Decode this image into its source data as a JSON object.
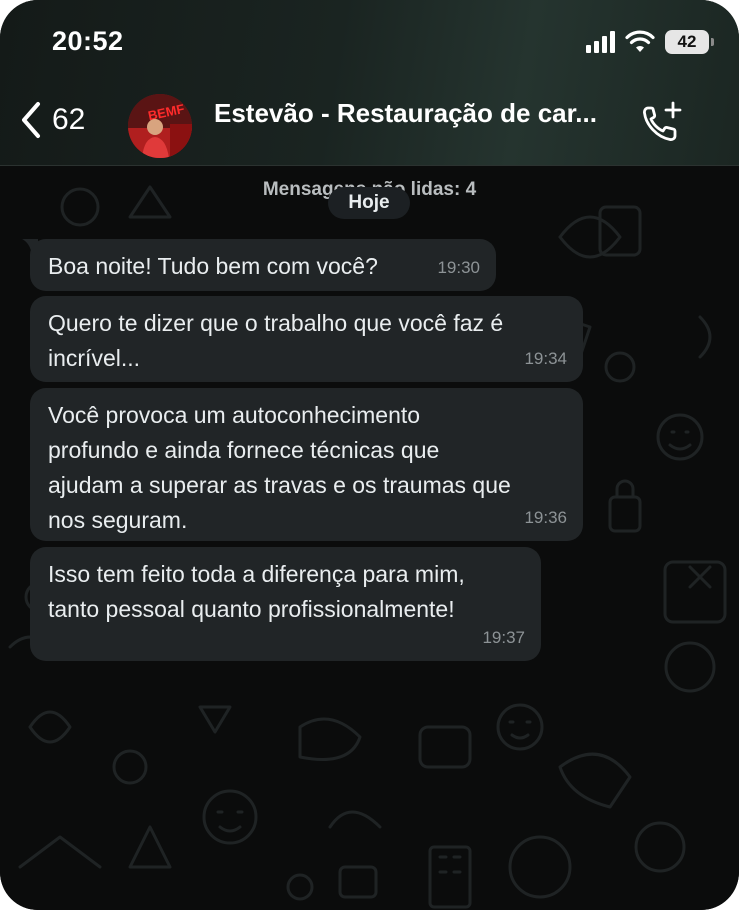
{
  "status_bar": {
    "time": "20:52",
    "battery": "42"
  },
  "header": {
    "back_count": "62",
    "contact_name": "Estevão - Restauração de car...",
    "avatar_text": "BEMF"
  },
  "chat": {
    "unread_text": "Mensagens não lidas: 4",
    "date_label": "Hoje",
    "messages": [
      {
        "text": "Boa noite! Tudo bem com você?",
        "time": "19:30"
      },
      {
        "text": "Quero te dizer que o trabalho que você faz é\nincrível...",
        "time": "19:34"
      },
      {
        "text": "Você provoca um autoconhecimento\nprofundo e ainda fornece técnicas que\najudam a superar as travas e os traumas que\nnos seguram.",
        "time": "19:36"
      },
      {
        "text": "Isso tem feito toda a diferença para mim,\ntanto pessoal quanto profissionalmente!",
        "time": "19:37"
      }
    ]
  },
  "icons": {
    "back": "chevron-left-icon",
    "call": "phone-plus-icon",
    "signal": "cellular-signal-icon",
    "wifi": "wifi-icon",
    "battery": "battery-icon"
  },
  "colors": {
    "background": "#0b0c0c",
    "bubble": "#212527",
    "header_accent": "#25342f",
    "text": "#e9edef",
    "timestamp": "#8d9396"
  }
}
